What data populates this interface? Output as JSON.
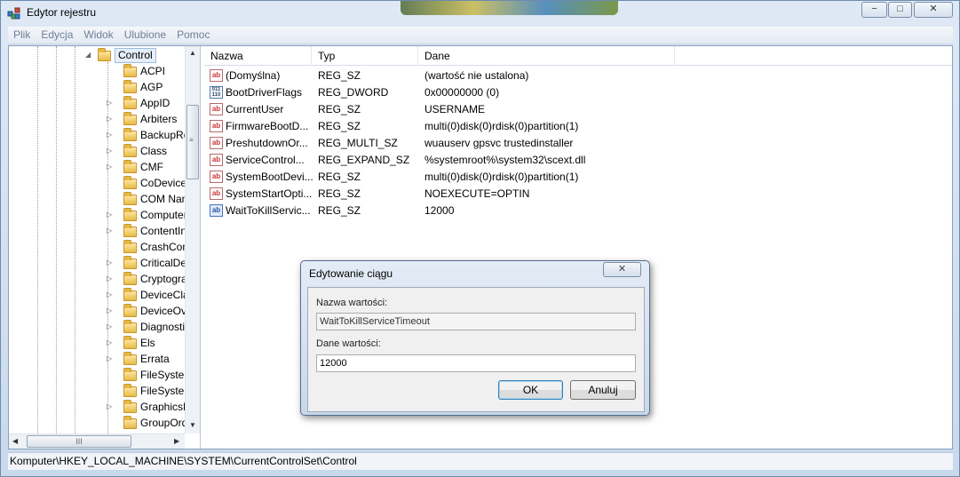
{
  "window": {
    "title": "Edytor rejestru",
    "controls": {
      "minimize": "−",
      "maximize": "□",
      "close": "✕"
    }
  },
  "menu": [
    "Plik",
    "Edycja",
    "Widok",
    "Ulubione",
    "Pomoc"
  ],
  "tree": {
    "selected": "Control",
    "items": [
      {
        "label": "ACPI",
        "expandable": false
      },
      {
        "label": "AGP",
        "expandable": false
      },
      {
        "label": "AppID",
        "expandable": true
      },
      {
        "label": "Arbiters",
        "expandable": true
      },
      {
        "label": "BackupRes",
        "expandable": true
      },
      {
        "label": "Class",
        "expandable": true
      },
      {
        "label": "CMF",
        "expandable": true
      },
      {
        "label": "CoDeviceIr",
        "expandable": false
      },
      {
        "label": "COM Nam",
        "expandable": false
      },
      {
        "label": "Computerl",
        "expandable": true
      },
      {
        "label": "ContentInc",
        "expandable": true
      },
      {
        "label": "CrashCont",
        "expandable": false
      },
      {
        "label": "CriticalDev",
        "expandable": true
      },
      {
        "label": "Cryptograp",
        "expandable": true
      },
      {
        "label": "DeviceClas",
        "expandable": true
      },
      {
        "label": "DeviceOve",
        "expandable": true
      },
      {
        "label": "Diagnostic",
        "expandable": true
      },
      {
        "label": "Els",
        "expandable": true
      },
      {
        "label": "Errata",
        "expandable": true
      },
      {
        "label": "FileSystem",
        "expandable": false
      },
      {
        "label": "FileSystem",
        "expandable": false
      },
      {
        "label": "GraphicsDr",
        "expandable": true
      },
      {
        "label": "GroupOrde",
        "expandable": false
      }
    ],
    "hscroll_thumb": "III"
  },
  "list": {
    "headers": {
      "name": "Nazwa",
      "type": "Typ",
      "data": "Dane"
    },
    "rows": [
      {
        "icon": "ab",
        "name": "(Domyślna)",
        "type": "REG_SZ",
        "data": "(wartość nie ustalona)"
      },
      {
        "icon": "bin",
        "name": "BootDriverFlags",
        "type": "REG_DWORD",
        "data": "0x00000000 (0)"
      },
      {
        "icon": "ab",
        "name": "CurrentUser",
        "type": "REG_SZ",
        "data": "USERNAME"
      },
      {
        "icon": "ab",
        "name": "FirmwareBootD...",
        "type": "REG_SZ",
        "data": "multi(0)disk(0)rdisk(0)partition(1)"
      },
      {
        "icon": "ab",
        "name": "PreshutdownOr...",
        "type": "REG_MULTI_SZ",
        "data": "wuauserv gpsvc trustedinstaller"
      },
      {
        "icon": "ab",
        "name": "ServiceControl...",
        "type": "REG_EXPAND_SZ",
        "data": "%systemroot%\\system32\\scext.dll"
      },
      {
        "icon": "ab",
        "name": "SystemBootDevi...",
        "type": "REG_SZ",
        "data": "multi(0)disk(0)rdisk(0)partition(1)"
      },
      {
        "icon": "ab",
        "name": "SystemStartOpti...",
        "type": "REG_SZ",
        "data": " NOEXECUTE=OPTIN"
      },
      {
        "icon": "ab-selected",
        "name": "WaitToKillServic...",
        "type": "REG_SZ",
        "data": "12000"
      }
    ]
  },
  "status": "Komputer\\HKEY_LOCAL_MACHINE\\SYSTEM\\CurrentControlSet\\Control",
  "dialog": {
    "title": "Edytowanie ciągu",
    "close": "✕",
    "value_name_label": "Nazwa wartości:",
    "value_name": "WaitToKillServiceTimeout",
    "value_data_label": "Dane wartości:",
    "value_data": "12000",
    "ok": "OK",
    "cancel": "Anuluj"
  }
}
